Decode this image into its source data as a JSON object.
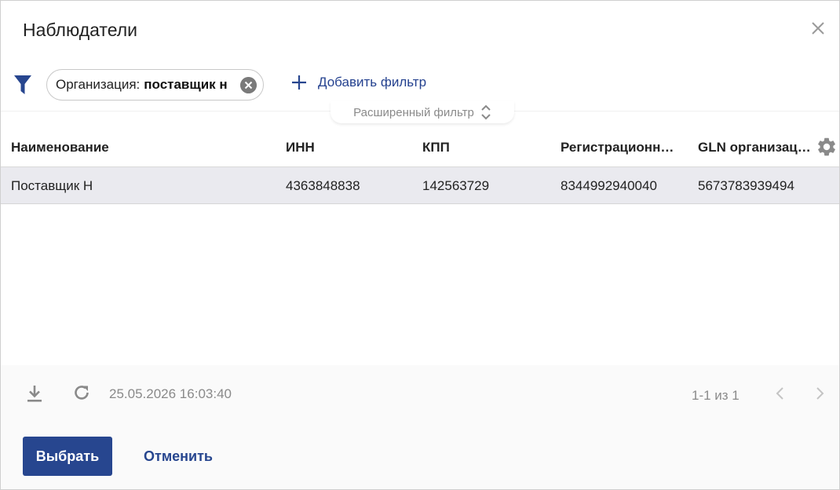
{
  "dialog": {
    "title": "Наблюдатели"
  },
  "filter": {
    "chip_label": "Организация:",
    "chip_value": "поставщик н",
    "add_filter_label": "Добавить фильтр",
    "advanced_filter_label": "Расширенный фильтр"
  },
  "table": {
    "columns": [
      "Наименование",
      "ИНН",
      "КПП",
      "Регистрационн…",
      "GLN организац…"
    ],
    "rows": [
      [
        "Поставщик Н",
        "4363848838",
        "142563729",
        "8344992940040",
        "5673783939494"
      ]
    ]
  },
  "footer": {
    "timestamp": "25.05.2026 16:03:40",
    "pagination": "1-1 из 1"
  },
  "actions": {
    "select_label": "Выбрать",
    "cancel_label": "Отменить"
  },
  "icons": {
    "close": "close-icon",
    "filter": "funnel-icon",
    "chip_remove": "clear-circle-icon",
    "add": "plus-icon",
    "expand": "unfold-icon",
    "settings": "gear-icon",
    "download": "download-icon",
    "refresh": "refresh-icon",
    "prev": "chevron-left-icon",
    "next": "chevron-right-icon"
  },
  "colors": {
    "accent": "#27468f",
    "selected_row": "#eaeaef",
    "muted_text": "#8a8a8a"
  }
}
